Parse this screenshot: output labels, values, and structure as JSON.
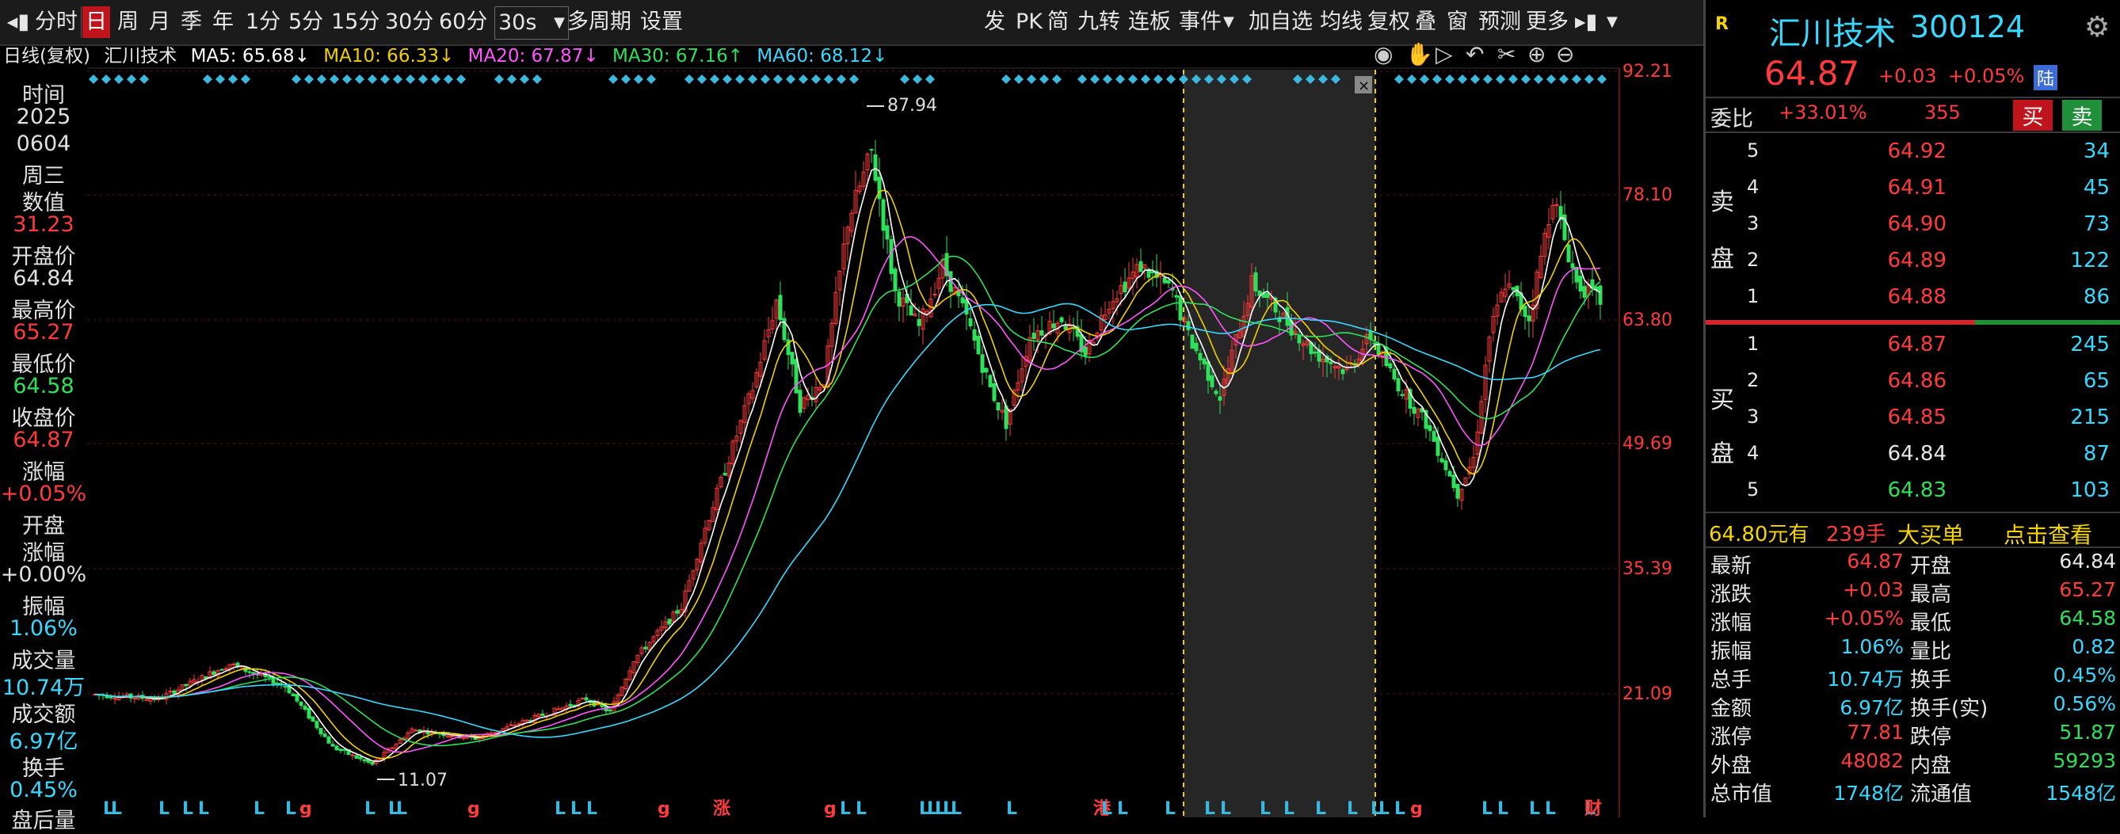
{
  "toolbar": {
    "items": [
      "分时",
      "日",
      "周",
      "月",
      "季",
      "年",
      "1分",
      "5分",
      "15分",
      "30分",
      "60分",
      "30s",
      "多周期",
      "设置"
    ],
    "active": "日",
    "right_items": [
      "发",
      "PK",
      "简",
      "九转",
      "连板",
      "事件",
      "加自选",
      "均线",
      "复权",
      "叠",
      "窗",
      "预测",
      "更多"
    ]
  },
  "chart_header": {
    "period": "日线(复权)",
    "stock": "汇川技术",
    "ma5": "MA5: 65.68↓",
    "ma10": "MA10: 66.33↓",
    "ma20": "MA20: 67.87↓",
    "ma30": "MA30: 67.16↑",
    "ma60": "MA60: 68.12↓"
  },
  "left_info": {
    "time_label": "时间",
    "year": "2025",
    "date": "0604",
    "weekday": "周三",
    "value_label": "数值",
    "value": "31.23",
    "open_label": "开盘价",
    "open": "64.84",
    "high_label": "最高价",
    "high": "65.27",
    "low_label": "最低价",
    "low": "64.58",
    "close_label": "收盘价",
    "close": "64.87",
    "change_label": "涨幅",
    "change": "+0.05%",
    "open_change_label1": "开盘",
    "open_change_label2": "涨幅",
    "open_change": "+0.00%",
    "amplitude_label": "振幅",
    "amplitude": "1.06%",
    "volume_label": "成交量",
    "volume": "10.74万",
    "turnover_label": "成交额",
    "turnover": "6.97亿",
    "hand_label": "换手",
    "hand": "0.45%",
    "after_label": "盘后量"
  },
  "y_axis": [
    "92.21",
    "78.10",
    "63.80",
    "49.69",
    "35.39",
    "21.09"
  ],
  "annotations": {
    "high": "87.94",
    "low": "11.07"
  },
  "quote": {
    "badge": "R",
    "name": "汇川技术",
    "code": "300124",
    "price": "64.87",
    "change": "+0.03",
    "change_pct": "+0.05%",
    "market_tag": "陆",
    "weibi_label": "委比",
    "weibi": "+33.01%",
    "weicha": "355",
    "buy_btn": "买",
    "sell_btn": "卖",
    "sell_label": [
      "卖",
      "盘"
    ],
    "buy_label": [
      "买",
      "盘"
    ],
    "asks": [
      {
        "lvl": "5",
        "price": "64.92",
        "vol": "34"
      },
      {
        "lvl": "4",
        "price": "64.91",
        "vol": "45"
      },
      {
        "lvl": "3",
        "price": "64.90",
        "vol": "73"
      },
      {
        "lvl": "2",
        "price": "64.89",
        "vol": "122"
      },
      {
        "lvl": "1",
        "price": "64.88",
        "vol": "86"
      }
    ],
    "bids": [
      {
        "lvl": "1",
        "price": "64.87",
        "vol": "245"
      },
      {
        "lvl": "2",
        "price": "64.86",
        "vol": "65"
      },
      {
        "lvl": "3",
        "price": "64.85",
        "vol": "215"
      },
      {
        "lvl": "4",
        "price": "64.84",
        "vol": "87"
      },
      {
        "lvl": "5",
        "price": "64.83",
        "vol": "103"
      }
    ],
    "big_order": {
      "price": "64.80元有",
      "qty": "239手",
      "text": "大买单",
      "link": "点击查看"
    },
    "stats": [
      {
        "l1": "最新",
        "v1": "64.87",
        "l2": "开盘",
        "v2": "64.84"
      },
      {
        "l1": "涨跌",
        "v1": "+0.03",
        "l2": "最高",
        "v2": "65.27"
      },
      {
        "l1": "涨幅",
        "v1": "+0.05%",
        "l2": "最低",
        "v2": "64.58"
      },
      {
        "l1": "振幅",
        "v1": "1.06%",
        "l2": "量比",
        "v2": "0.82"
      },
      {
        "l1": "总手",
        "v1": "10.74万",
        "l2": "换手",
        "v2": "0.45%"
      },
      {
        "l1": "金额",
        "v1": "6.97亿",
        "l2": "换手(实)",
        "v2": "0.56%"
      },
      {
        "l1": "涨停",
        "v1": "77.81",
        "l2": "跌停",
        "v2": "51.87"
      },
      {
        "l1": "外盘",
        "v1": "48082",
        "l2": "内盘",
        "v2": "59293"
      },
      {
        "l1": "总市值",
        "v1": "1748亿",
        "l2": "流通值",
        "v2": "1548亿"
      }
    ]
  },
  "bottom_tags": [
    "L",
    "L",
    "L",
    "L",
    "L",
    "L",
    "L",
    "g",
    "L",
    "L",
    "L",
    "g",
    "L",
    "L",
    "L",
    "g",
    "涨",
    "g",
    "L",
    "L",
    "L",
    "L",
    "L",
    "L",
    "L",
    "L",
    "港",
    "L",
    "L",
    "L",
    "L",
    "L",
    "L",
    "L",
    "L",
    "L",
    "L",
    "L",
    "L",
    "g",
    "L",
    "L",
    "L",
    "L",
    "L",
    "财"
  ],
  "colors": {
    "up": "#ff3b3b",
    "down": "#2ee05a",
    "ma5": "#ffffff",
    "ma10": "#f0d000",
    "ma20": "#ff55ff",
    "ma30": "#2ee05a",
    "ma60": "#38d8ff"
  }
}
